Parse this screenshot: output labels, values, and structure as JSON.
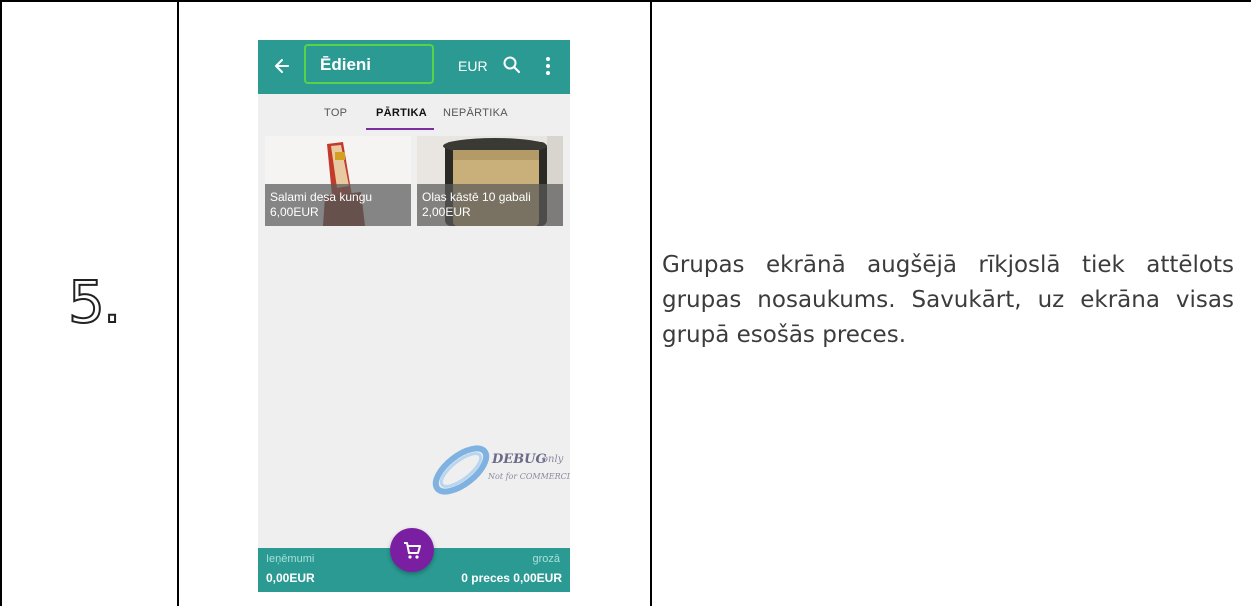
{
  "step": {
    "number": "5."
  },
  "description": "Grupas ekrānā augšējā rīkjoslā tiek attēlots grupas nosaukums. Savukārt, uz ekrāna visas grupā esošās preces.",
  "app": {
    "toolbar": {
      "title": "Ēdieni",
      "currency": "EUR",
      "icons": [
        "back-arrow-icon",
        "search-icon",
        "more-vert-icon"
      ]
    },
    "tabs": [
      {
        "label": "TOP",
        "active": false
      },
      {
        "label": "PĀRTIKA",
        "active": true
      },
      {
        "label": "NEPĀRTIKA",
        "active": false
      }
    ],
    "products": [
      {
        "name": "Salami desa kungu",
        "price": "6,00EUR"
      },
      {
        "name": "Olas kāstē 10 gabali",
        "price": "2,00EUR"
      }
    ],
    "watermark": {
      "line1": "DEBUG",
      "line1b": "only",
      "line2": "Not for COMMERCIAL"
    },
    "bottom_bar": {
      "left_label": "Ieņēmumi",
      "left_value": "0,00EUR",
      "right_label": "grozā",
      "right_value": "0 preces 0,00EUR"
    },
    "fab_icon": "cart-icon",
    "colors": {
      "primary": "#2b9a93",
      "accent": "#7b1fa2",
      "highlight": "#58d24a"
    }
  }
}
